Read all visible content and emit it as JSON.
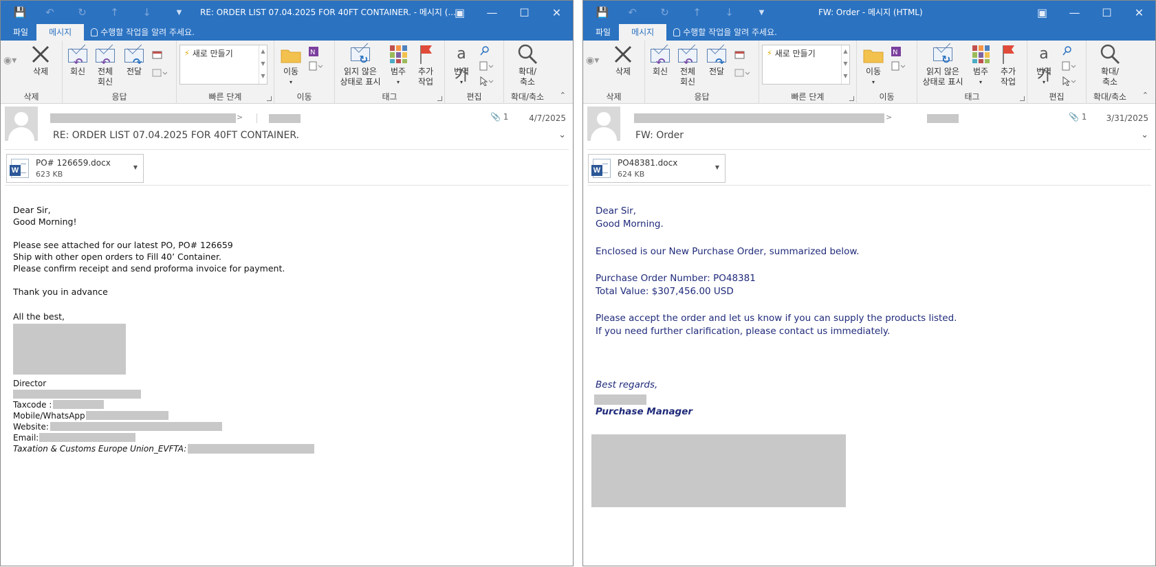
{
  "ribbon": {
    "tab_file": "파일",
    "tab_message": "메시지",
    "tell_me": "수행할 작업을 알려 주세요.",
    "delete_group": "삭제",
    "delete_btn": "삭제",
    "respond_group": "응답",
    "reply": "회신",
    "reply_all_1": "전체",
    "reply_all_2": "회신",
    "forward": "전달",
    "quicksteps_group": "빠른 단계",
    "quicksteps_new": "새로 만들기",
    "move_group": "이동",
    "move_btn": "이동",
    "tags_group": "태그",
    "mark_unread_1": "읽지 않은",
    "mark_unread_2": "상태로 표시",
    "categorize": "범주",
    "followup_1": "추가",
    "followup_2": "작업",
    "editing_group": "편집",
    "translate": "번역",
    "zoom_group": "확대/축소",
    "zoom_1": "확대/",
    "zoom_2": "축소"
  },
  "left": {
    "title": "RE: ORDER LIST 07.04.2025 FOR 40FT CONTAINER. - 메시지 (...",
    "subject": "RE: ORDER LIST 07.04.2025 FOR 40FT CONTAINER.",
    "attachment_count": "1",
    "date": "4/7/2025",
    "attachment": {
      "name": "PO# 126659.docx",
      "size": "623 KB"
    },
    "body": [
      "Dear Sir,",
      "Good Morning!",
      "",
      "Please see attached for our latest PO, PO# 126659",
      "Ship with other open orders to Fill 40’ Container.",
      "Please confirm receipt and send proforma invoice for payment.",
      "",
      "Thank you in advance",
      "",
      "All the best,"
    ],
    "sig_title": "Director",
    "sig_taxcode": "Taxcode :",
    "sig_mobile": "Mobile/WhatsApp:",
    "sig_website": "Website:",
    "sig_email": "Email:",
    "sig_tax_eu": "Taxation & Customs Europe Union_EVFTA:"
  },
  "right": {
    "title": "FW: Order - 메시지 (HTML)",
    "subject": "FW: Order",
    "attachment_count": "1",
    "date": "3/31/2025",
    "attachment": {
      "name": "PO48381.docx",
      "size": "624 KB"
    },
    "greeting_1": "Dear Sir,",
    "greeting_2": "Good Morning.",
    "intro": "Enclosed is our New Purchase Order, summarized below.",
    "po_number": "Purchase Order Number: PO48381",
    "total": "Total Value: $307,456.00 USD",
    "accept": "Please accept the order and let us know if you can supply the products listed.",
    "clarify": "If you need further clarification, please contact us immediately.",
    "regards": "Best regards,",
    "role": "Purchase Manager"
  },
  "colors": {
    "titlebar": "#2b72c1",
    "ribbon_bg": "#f2f2f2",
    "redaction": "#c8c8c8",
    "right_body_text": "#1f2a7a"
  }
}
